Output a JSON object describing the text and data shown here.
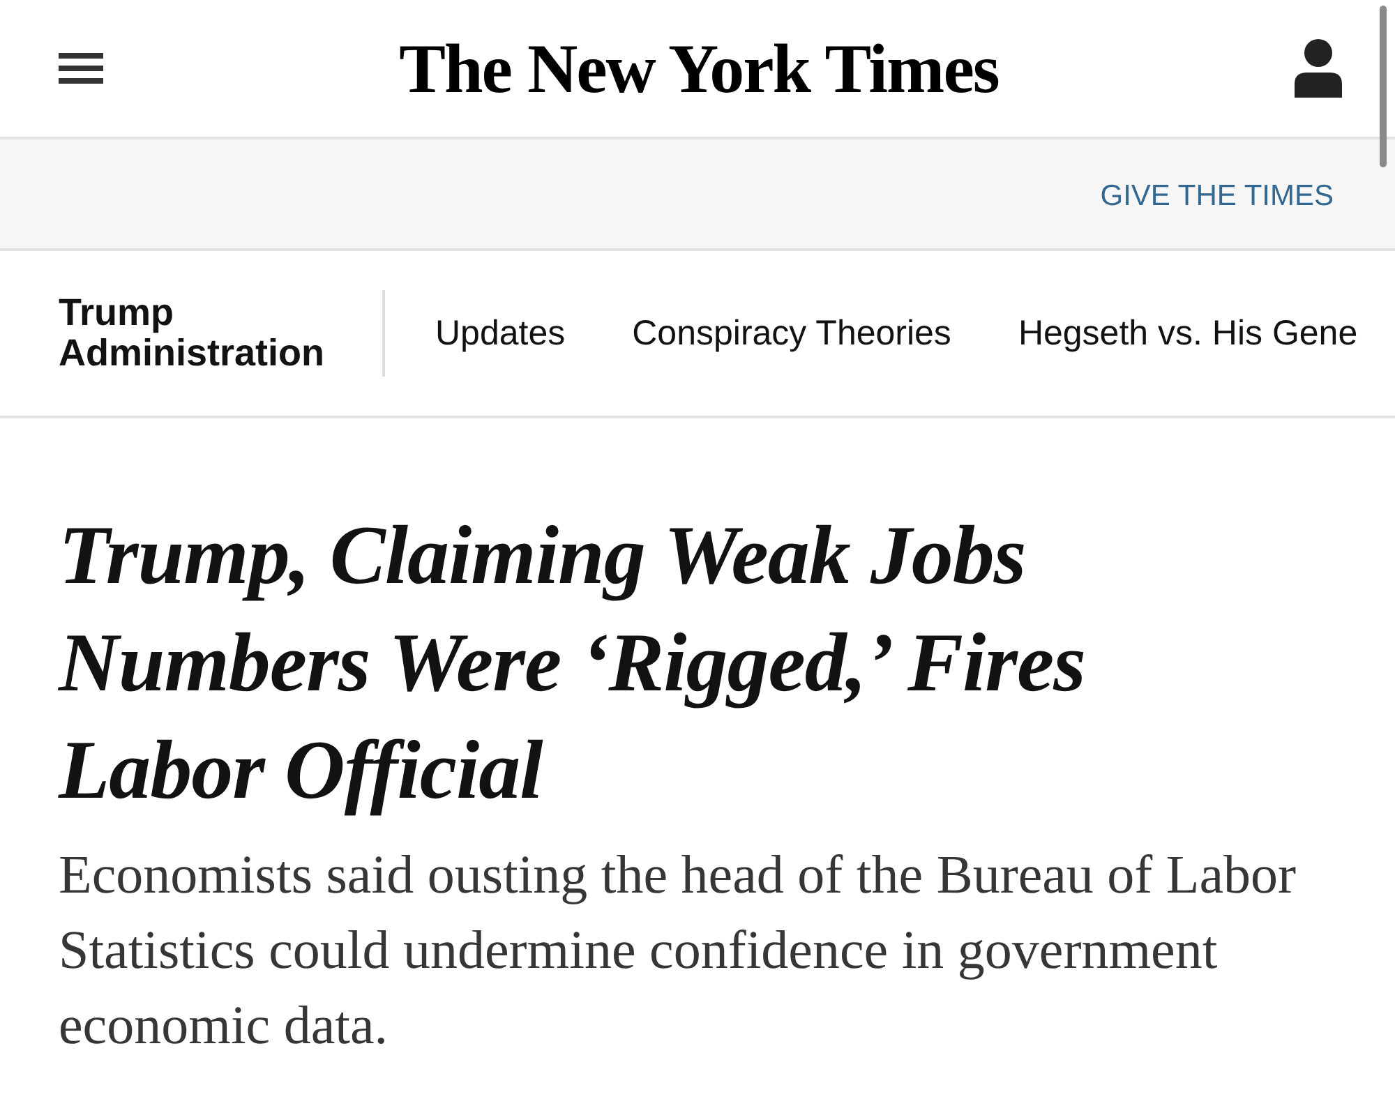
{
  "header": {
    "logo": "The New York Times"
  },
  "promo_band": {
    "link": "GIVE THE TIMES"
  },
  "section_nav": {
    "section": "Trump Administration",
    "items": [
      {
        "label": "Updates"
      },
      {
        "label": "Conspiracy Theories"
      },
      {
        "label": "Hegseth vs. His Gene"
      }
    ]
  },
  "article": {
    "headline": "Trump, Claiming Weak Jobs Numbers Were ‘Rigged,’ Fires Labor Official",
    "summary": "Economists said ousting the head of the Bureau of Labor Statistics could undermine confidence in government economic data."
  }
}
